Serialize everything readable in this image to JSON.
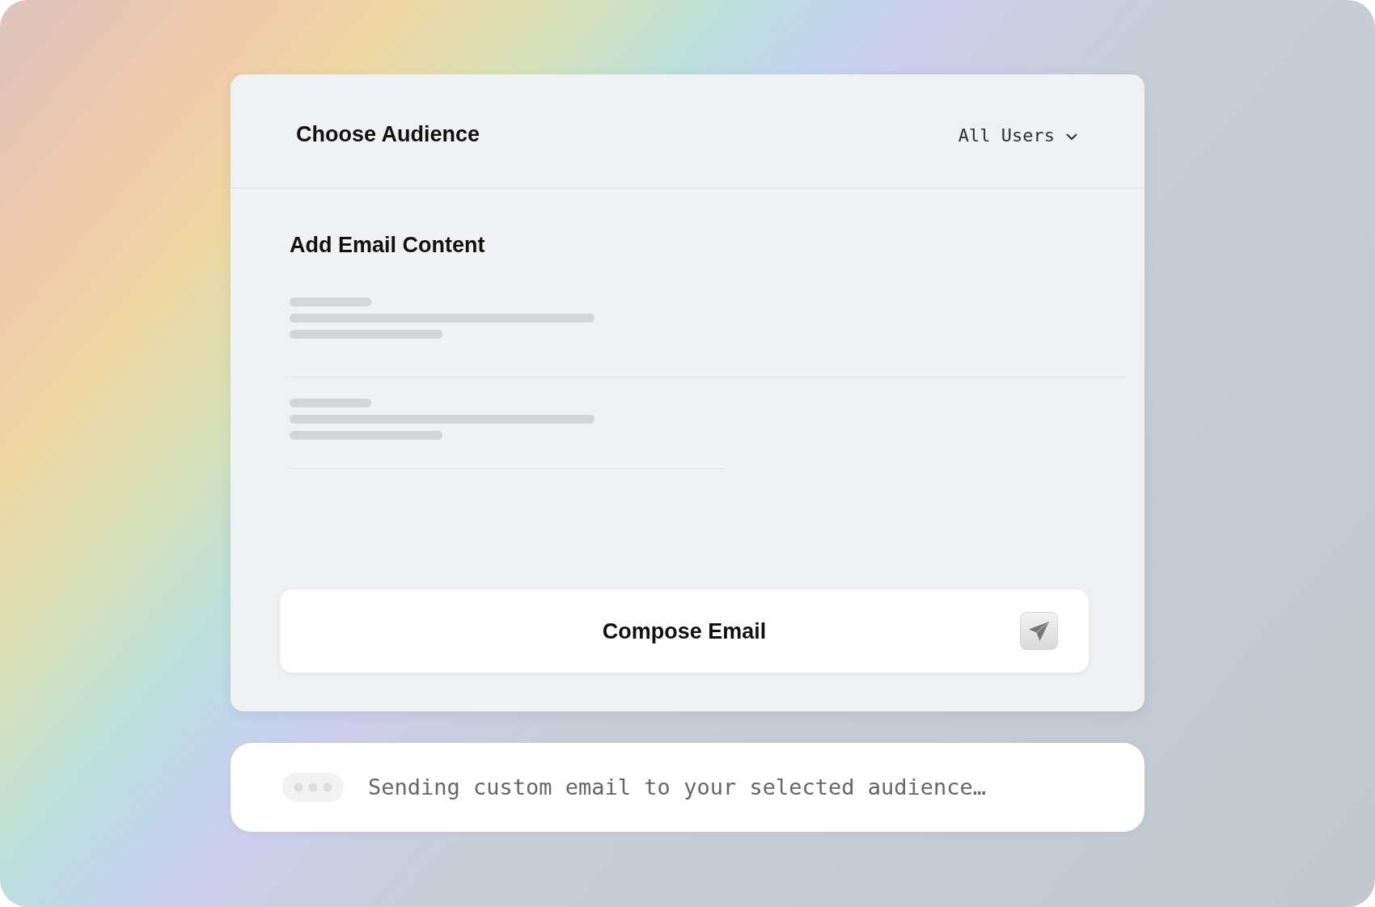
{
  "audience_section": {
    "title": "Choose Audience",
    "dropdown": {
      "value": "All Users"
    }
  },
  "content_section": {
    "title": "Add Email Content"
  },
  "compose_button": {
    "label": "Compose Email"
  },
  "status": {
    "message": "Sending custom email to your selected audience…"
  }
}
